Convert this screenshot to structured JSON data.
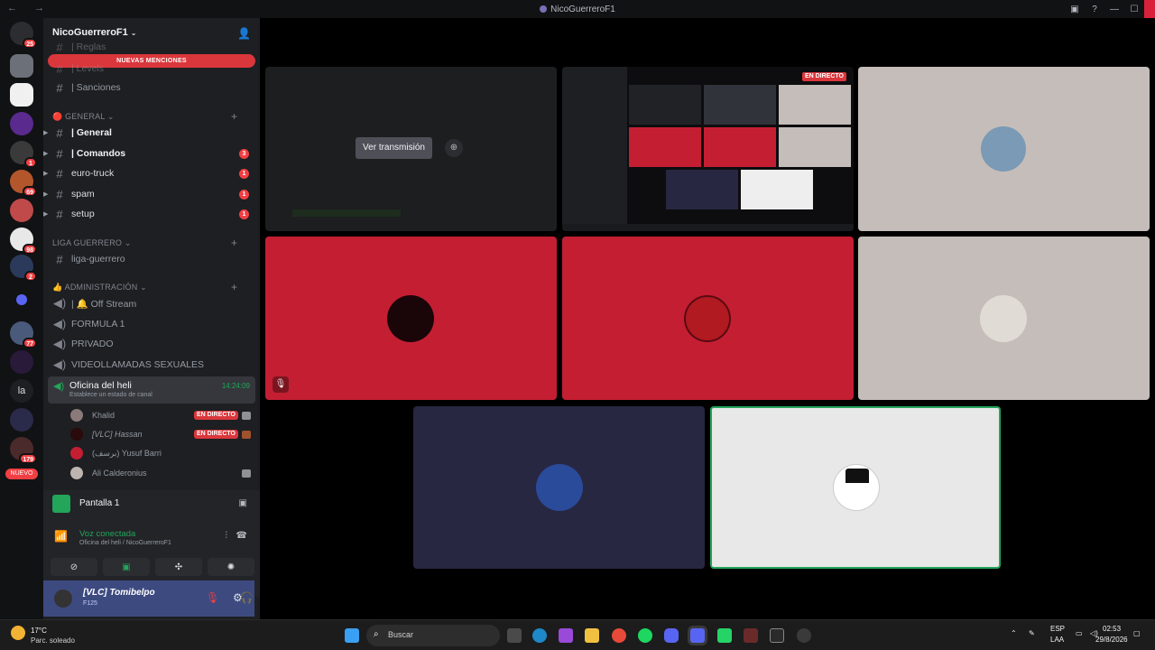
{
  "window": {
    "title": "NicoGuerreroF1",
    "nav_back": "←",
    "nav_forward": "→"
  },
  "server_rail": {
    "badges": [
      "25",
      "1",
      "69",
      "98",
      "2",
      "77",
      "179"
    ],
    "letter_server": "la",
    "new_label": "NUEVO"
  },
  "guild": {
    "name": "NicoGuerreroF1",
    "new_mentions": "NUEVAS MENCIONES"
  },
  "channels_top": [
    {
      "name": "| Reglas",
      "icon": "#"
    },
    {
      "name": "| Levels",
      "icon": "#"
    },
    {
      "name": "| Sanciones",
      "icon": "#"
    }
  ],
  "categories": {
    "general": "GENERAL",
    "liga": "LIGA GUERRERO",
    "admin": "ADMINISTRACIÓN"
  },
  "general_channels": [
    {
      "name": "| General",
      "badge": ""
    },
    {
      "name": "| Comandos",
      "badge": "3"
    },
    {
      "name": "euro-truck",
      "badge": "1"
    },
    {
      "name": "spam",
      "badge": "1"
    },
    {
      "name": "setup",
      "badge": "1"
    }
  ],
  "liga_channels": [
    {
      "name": "liga-guerrero"
    }
  ],
  "voice_channels": [
    {
      "name": "| 🔔 Off Stream"
    },
    {
      "name": "FORMULA 1"
    },
    {
      "name": "PRIVADO"
    },
    {
      "name": "VIDEOLLAMADAS SEXUALES"
    }
  ],
  "active_voice": {
    "name": "Oficina del heli",
    "status": "Establece un estado de canal",
    "time": "14:24:09",
    "users": [
      {
        "name": "Khalid",
        "live": "EN DIRECTO"
      },
      {
        "name": "[VLC] Hassan",
        "live": "EN DIRECTO"
      },
      {
        "name": "(برسف) Yusuf Barri",
        "live": ""
      },
      {
        "name": "Ali Calderonius",
        "live": ""
      }
    ]
  },
  "panel": {
    "screen_label": "Pantalla 1",
    "voice_connected": "Voz conectada",
    "voice_sub": "Oficina del heli / NicoGuerreroF1"
  },
  "user": {
    "name": "[VLC] Tomibelpo",
    "status": "F125"
  },
  "stage": {
    "watch_label": "Ver transmisión",
    "live_label": "EN DIRECTO"
  },
  "colors": {
    "red_tile": "#c41e33",
    "beige_tile": "#c5bdb9",
    "navy_tile": "#272741",
    "white_tile": "#e8e8e8",
    "speaking_border": "#23a55a"
  },
  "taskbar": {
    "temp": "17°C",
    "condition": "Parc. soleado",
    "search_placeholder": "Buscar",
    "lang_top": "ESP",
    "lang_bottom": "LAA",
    "time": "02:53",
    "date": "29/8/2026"
  }
}
